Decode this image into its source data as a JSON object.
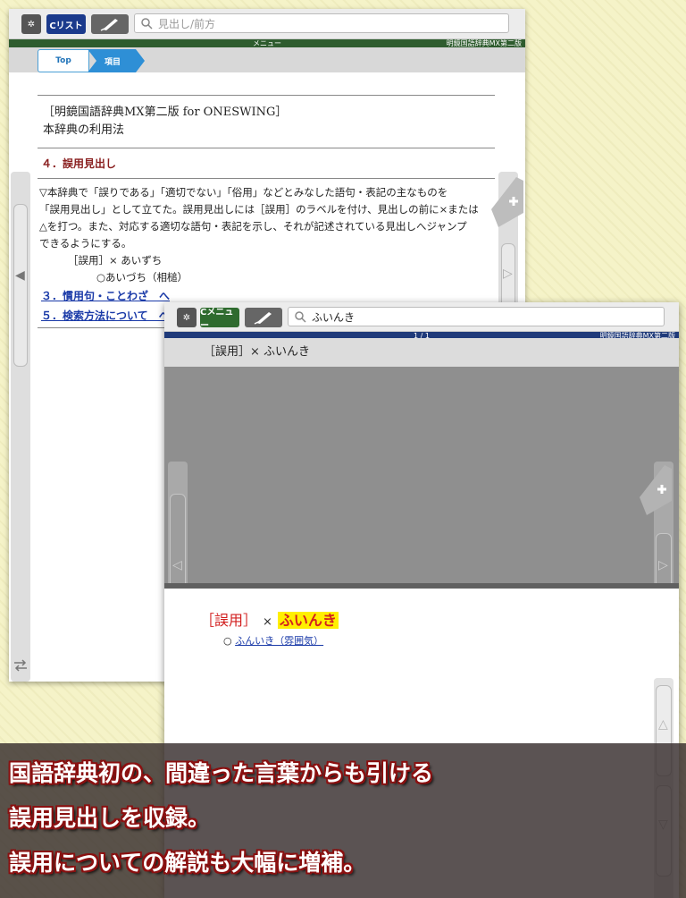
{
  "window1": {
    "toolbar": {
      "gear_label": "✲",
      "list_label": "Cリスト",
      "search_placeholder": "見出し/前方"
    },
    "menubar": {
      "center": "メニュー",
      "right": "明鏡国語辞典MX第二版"
    },
    "breadcrumb": {
      "top": "Top",
      "item": "項目"
    },
    "doc": {
      "title_line1": "［明鏡国語辞典MX第二版 for ONESWING］",
      "title_line2": "本辞典の利用法",
      "section": "４．誤用見出し",
      "body_lines": [
        "▽本辞典で「誤りである」「適切でない」「俗用」などとみなした語句・表記の主なものを",
        "「誤用見出し」として立てた。誤用見出しには［誤用］のラベルを付け、見出しの前に×または",
        "△を打つ。また、対応する適切な語句・表記を示し、それが記述されている見出しへジャンプ",
        "できるようにする。"
      ],
      "example1": "［誤用］× あいずち",
      "example2": "○あいづち（相槌）",
      "links": [
        "３．慣用句・ことわざ　へ",
        "５．検索方法について　へ"
      ]
    }
  },
  "window2": {
    "toolbar": {
      "gear_label": "✲",
      "menu_label": "Cメニュー",
      "search_value": "ふいんき"
    },
    "menubar": {
      "center": "1 / 1",
      "right": "明鏡国語辞典MX第二版"
    },
    "headword": "［誤用］× ふいんき",
    "result": {
      "label": "［誤用］",
      "mark": "×",
      "word": "ふいんき",
      "sub_mark": "○",
      "sub_link": "ふんいき（雰囲気）"
    }
  },
  "banner": {
    "lines": [
      "国語辞典初の、間違った言葉からも引ける",
      "誤用見出しを収録。",
      "誤用についての解説も大幅に増補。"
    ]
  },
  "colors": {
    "accent_blue": "#1b3a8c",
    "accent_green": "#2f6b2f",
    "banner_outline": "#8a1010",
    "highlight": "#ffef00"
  }
}
